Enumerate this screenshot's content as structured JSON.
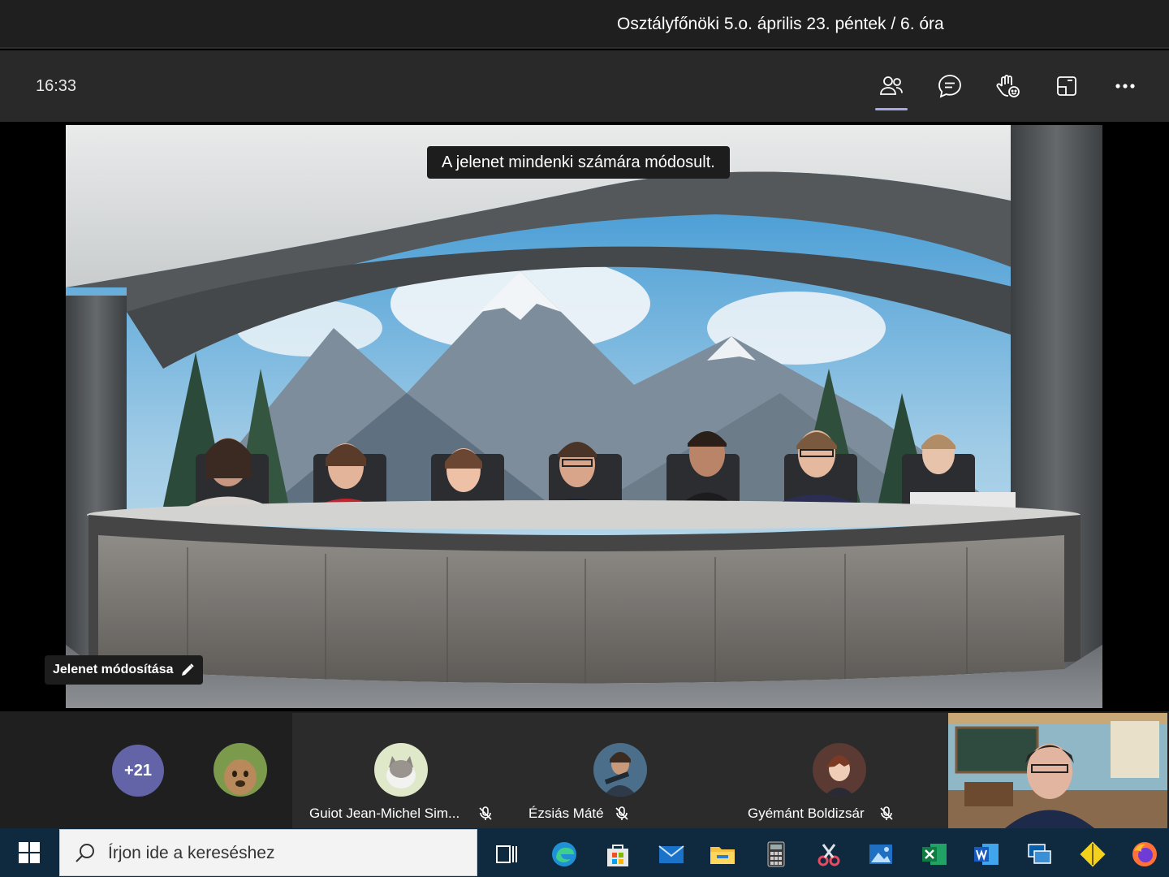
{
  "window": {
    "title": "Osztályfőnöki 5.o. április 23. péntek / 6. óra"
  },
  "toolbar": {
    "time": "16:33",
    "buttons": [
      {
        "icon": "people-icon",
        "active": true
      },
      {
        "icon": "chat-icon",
        "active": false
      },
      {
        "icon": "raise-hand-icon",
        "active": false
      },
      {
        "icon": "rooms-icon",
        "active": false
      },
      {
        "icon": "more-icon",
        "active": false
      }
    ]
  },
  "stage": {
    "notification": "A jelenet mindenki számára módosult.",
    "edit_scene_label": "Jelenet módosítása"
  },
  "participants": {
    "overflow_count": "+21",
    "tiles": [
      {
        "name": "Guiot Jean-Michel Sim...",
        "muted": true
      },
      {
        "name": "Ézsiás Máté",
        "muted": true
      },
      {
        "name": "Gyémánt Boldizsár",
        "muted": true
      }
    ]
  },
  "taskbar": {
    "search_placeholder": "Írjon ide a kereséshez",
    "apps": [
      "task-view-icon",
      "edge-icon",
      "store-icon",
      "mail-icon",
      "file-explorer-icon",
      "calculator-icon",
      "snipping-tool-icon",
      "photos-icon",
      "excel-icon",
      "word-icon",
      "remote-desktop-icon",
      "sticky-app-icon",
      "firefox-icon"
    ]
  }
}
